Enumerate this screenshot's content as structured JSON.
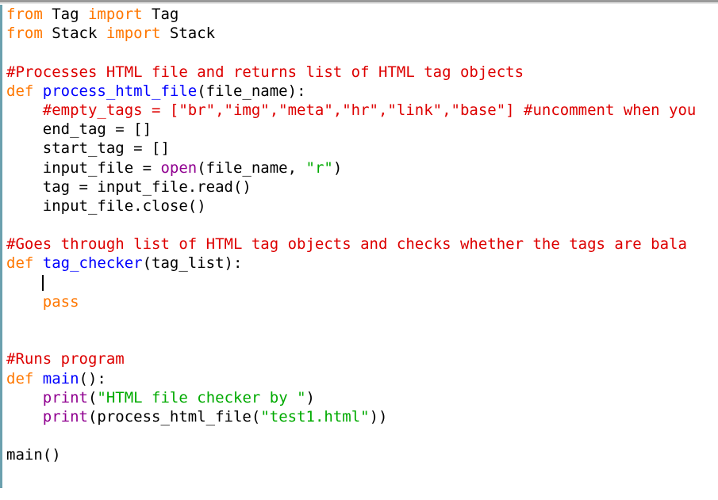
{
  "window": {
    "kind": "python-idle-editor",
    "accent_border_color": "#6ba0ae",
    "chrome_border_color": "#9a9a9a",
    "background_color": "#ffffff"
  },
  "syntax_colors": {
    "keyword": "#ff7700",
    "builtin": "#900090",
    "string": "#00aa00",
    "comment": "#dd0000",
    "definition": "#0000ff",
    "plain": "#000000"
  },
  "caret": {
    "line_index": 14,
    "column": 4
  },
  "code": {
    "lines": [
      {
        "index": 0,
        "tokens": [
          {
            "t": "from ",
            "c": "keyword"
          },
          {
            "t": "Tag ",
            "c": "plain"
          },
          {
            "t": "import ",
            "c": "keyword"
          },
          {
            "t": "Tag",
            "c": "plain"
          }
        ]
      },
      {
        "index": 1,
        "tokens": [
          {
            "t": "from ",
            "c": "keyword"
          },
          {
            "t": "Stack ",
            "c": "plain"
          },
          {
            "t": "import ",
            "c": "keyword"
          },
          {
            "t": "Stack",
            "c": "plain"
          }
        ]
      },
      {
        "index": 2,
        "tokens": []
      },
      {
        "index": 3,
        "tokens": [
          {
            "t": "#Processes HTML file and returns list of HTML tag objects",
            "c": "comment"
          }
        ]
      },
      {
        "index": 4,
        "tokens": [
          {
            "t": "def ",
            "c": "keyword"
          },
          {
            "t": "process_html_file",
            "c": "definition"
          },
          {
            "t": "(file_name):",
            "c": "plain"
          }
        ]
      },
      {
        "index": 5,
        "tokens": [
          {
            "t": "    #empty_tags = [\"br\",\"img\",\"meta\",\"hr\",\"link\",\"base\"] #uncomment when you",
            "c": "comment"
          }
        ]
      },
      {
        "index": 6,
        "tokens": [
          {
            "t": "    end_tag = []",
            "c": "plain"
          }
        ]
      },
      {
        "index": 7,
        "tokens": [
          {
            "t": "    start_tag = []",
            "c": "plain"
          }
        ]
      },
      {
        "index": 8,
        "tokens": [
          {
            "t": "    input_file = ",
            "c": "plain"
          },
          {
            "t": "open",
            "c": "builtin"
          },
          {
            "t": "(file_name, ",
            "c": "plain"
          },
          {
            "t": "\"r\"",
            "c": "string"
          },
          {
            "t": ")",
            "c": "plain"
          }
        ]
      },
      {
        "index": 9,
        "tokens": [
          {
            "t": "    tag = input_file.read()",
            "c": "plain"
          }
        ]
      },
      {
        "index": 10,
        "tokens": [
          {
            "t": "    input_file.close()",
            "c": "plain"
          }
        ]
      },
      {
        "index": 11,
        "tokens": []
      },
      {
        "index": 12,
        "tokens": [
          {
            "t": "#Goes through list of HTML tag objects and checks whether the tags are bala",
            "c": "comment"
          }
        ]
      },
      {
        "index": 13,
        "tokens": [
          {
            "t": "def ",
            "c": "keyword"
          },
          {
            "t": "tag_checker",
            "c": "definition"
          },
          {
            "t": "(tag_list):",
            "c": "plain"
          }
        ]
      },
      {
        "index": 14,
        "tokens": [
          {
            "t": "    ",
            "c": "plain"
          }
        ],
        "caret": true
      },
      {
        "index": 15,
        "tokens": [
          {
            "t": "    ",
            "c": "plain"
          },
          {
            "t": "pass",
            "c": "keyword"
          }
        ]
      },
      {
        "index": 16,
        "tokens": []
      },
      {
        "index": 17,
        "tokens": []
      },
      {
        "index": 18,
        "tokens": [
          {
            "t": "#Runs program",
            "c": "comment"
          }
        ]
      },
      {
        "index": 19,
        "tokens": [
          {
            "t": "def ",
            "c": "keyword"
          },
          {
            "t": "main",
            "c": "definition"
          },
          {
            "t": "():",
            "c": "plain"
          }
        ]
      },
      {
        "index": 20,
        "tokens": [
          {
            "t": "    ",
            "c": "plain"
          },
          {
            "t": "print",
            "c": "builtin"
          },
          {
            "t": "(",
            "c": "plain"
          },
          {
            "t": "\"HTML file checker by \"",
            "c": "string"
          },
          {
            "t": ")",
            "c": "plain"
          }
        ]
      },
      {
        "index": 21,
        "tokens": [
          {
            "t": "    ",
            "c": "plain"
          },
          {
            "t": "print",
            "c": "builtin"
          },
          {
            "t": "(process_html_file(",
            "c": "plain"
          },
          {
            "t": "\"test1.html\"",
            "c": "string"
          },
          {
            "t": "))",
            "c": "plain"
          }
        ]
      },
      {
        "index": 22,
        "tokens": []
      },
      {
        "index": 23,
        "tokens": [
          {
            "t": "main()",
            "c": "plain"
          }
        ]
      },
      {
        "index": 24,
        "tokens": []
      },
      {
        "index": 25,
        "tokens": []
      }
    ]
  }
}
